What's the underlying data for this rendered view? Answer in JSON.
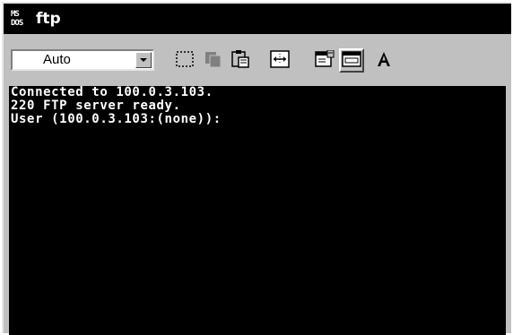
{
  "window": {
    "title": "ftp",
    "icon_text": [
      "MS",
      "DOS"
    ]
  },
  "toolbar": {
    "font_value": "Auto",
    "buttons": [
      {
        "name": "mark-icon"
      },
      {
        "name": "copy-icon"
      },
      {
        "name": "paste-icon"
      },
      {
        "name": "fullscreen-icon"
      },
      {
        "name": "properties-icon"
      },
      {
        "name": "background-icon"
      },
      {
        "name": "font-icon"
      }
    ]
  },
  "console": {
    "lines": [
      "Connected to 100.0.3.103.",
      "220 FTP server ready.",
      "User (100.0.3.103:(none)):"
    ]
  },
  "colors": {
    "title_bg": "#000000",
    "chrome": "#c0c0c0",
    "console_bg": "#000000",
    "console_text": "#ffffff"
  }
}
